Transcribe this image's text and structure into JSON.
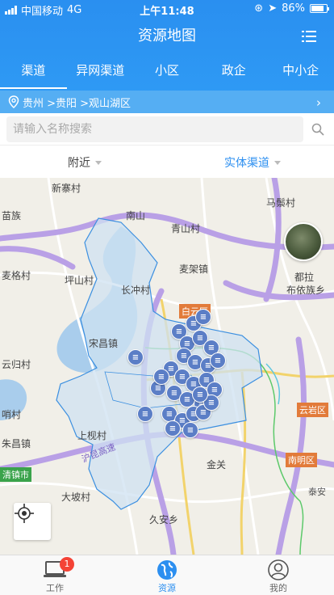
{
  "status_bar": {
    "carrier": "中国移动",
    "network": "4G",
    "time": "上午11:48",
    "battery": "86%",
    "battery_level": 0.86
  },
  "header": {
    "title": "资源地图",
    "menu_icon": "list-icon"
  },
  "tabs": [
    {
      "label": "渠道",
      "active": true
    },
    {
      "label": "异网渠道",
      "active": false
    },
    {
      "label": "小区",
      "active": false
    },
    {
      "label": "政企",
      "active": false
    },
    {
      "label": "中小企",
      "active": false
    }
  ],
  "breadcrumb": {
    "text": "贵州 >贵阳 >观山湖区",
    "icon": "location-pin-icon"
  },
  "search": {
    "placeholder": "请输入名称搜索",
    "value": ""
  },
  "filters": {
    "scope": "附近",
    "channel_type": "实体渠道"
  },
  "map": {
    "labels": [
      "新寨村",
      "马鬃村",
      "苗族",
      "南山",
      "青山村",
      "麦架镇",
      "坪山村",
      "麦格村",
      "长冲村",
      "都拉",
      "布依族乡",
      "宋昌镇",
      "云归村",
      "上枧村",
      "金关",
      "大坡村",
      "久安乡",
      "朱昌镇",
      "哨村"
    ],
    "district_tags": [
      {
        "label": "白云区",
        "color": "#e27b3a"
      },
      {
        "label": "云岩区",
        "color": "#e27b3a"
      },
      {
        "label": "南明区",
        "color": "#e27b3a"
      },
      {
        "label": "清镇市",
        "color": "#3aa34b"
      }
    ],
    "road_labels": [
      "沪昆高速",
      "泰安"
    ],
    "colors": {
      "region_fill": "#cfe2f2",
      "region_stroke": "#3b8fe0",
      "marker": "#5b7ec6",
      "water": "#a9cdec",
      "highway": "#b9a0e6"
    }
  },
  "tabbar": [
    {
      "label": "工作",
      "icon": "laptop-icon",
      "badge": "1",
      "active": false
    },
    {
      "label": "资源",
      "icon": "globe-icon",
      "active": true
    },
    {
      "label": "我的",
      "icon": "user-icon",
      "active": false
    }
  ]
}
